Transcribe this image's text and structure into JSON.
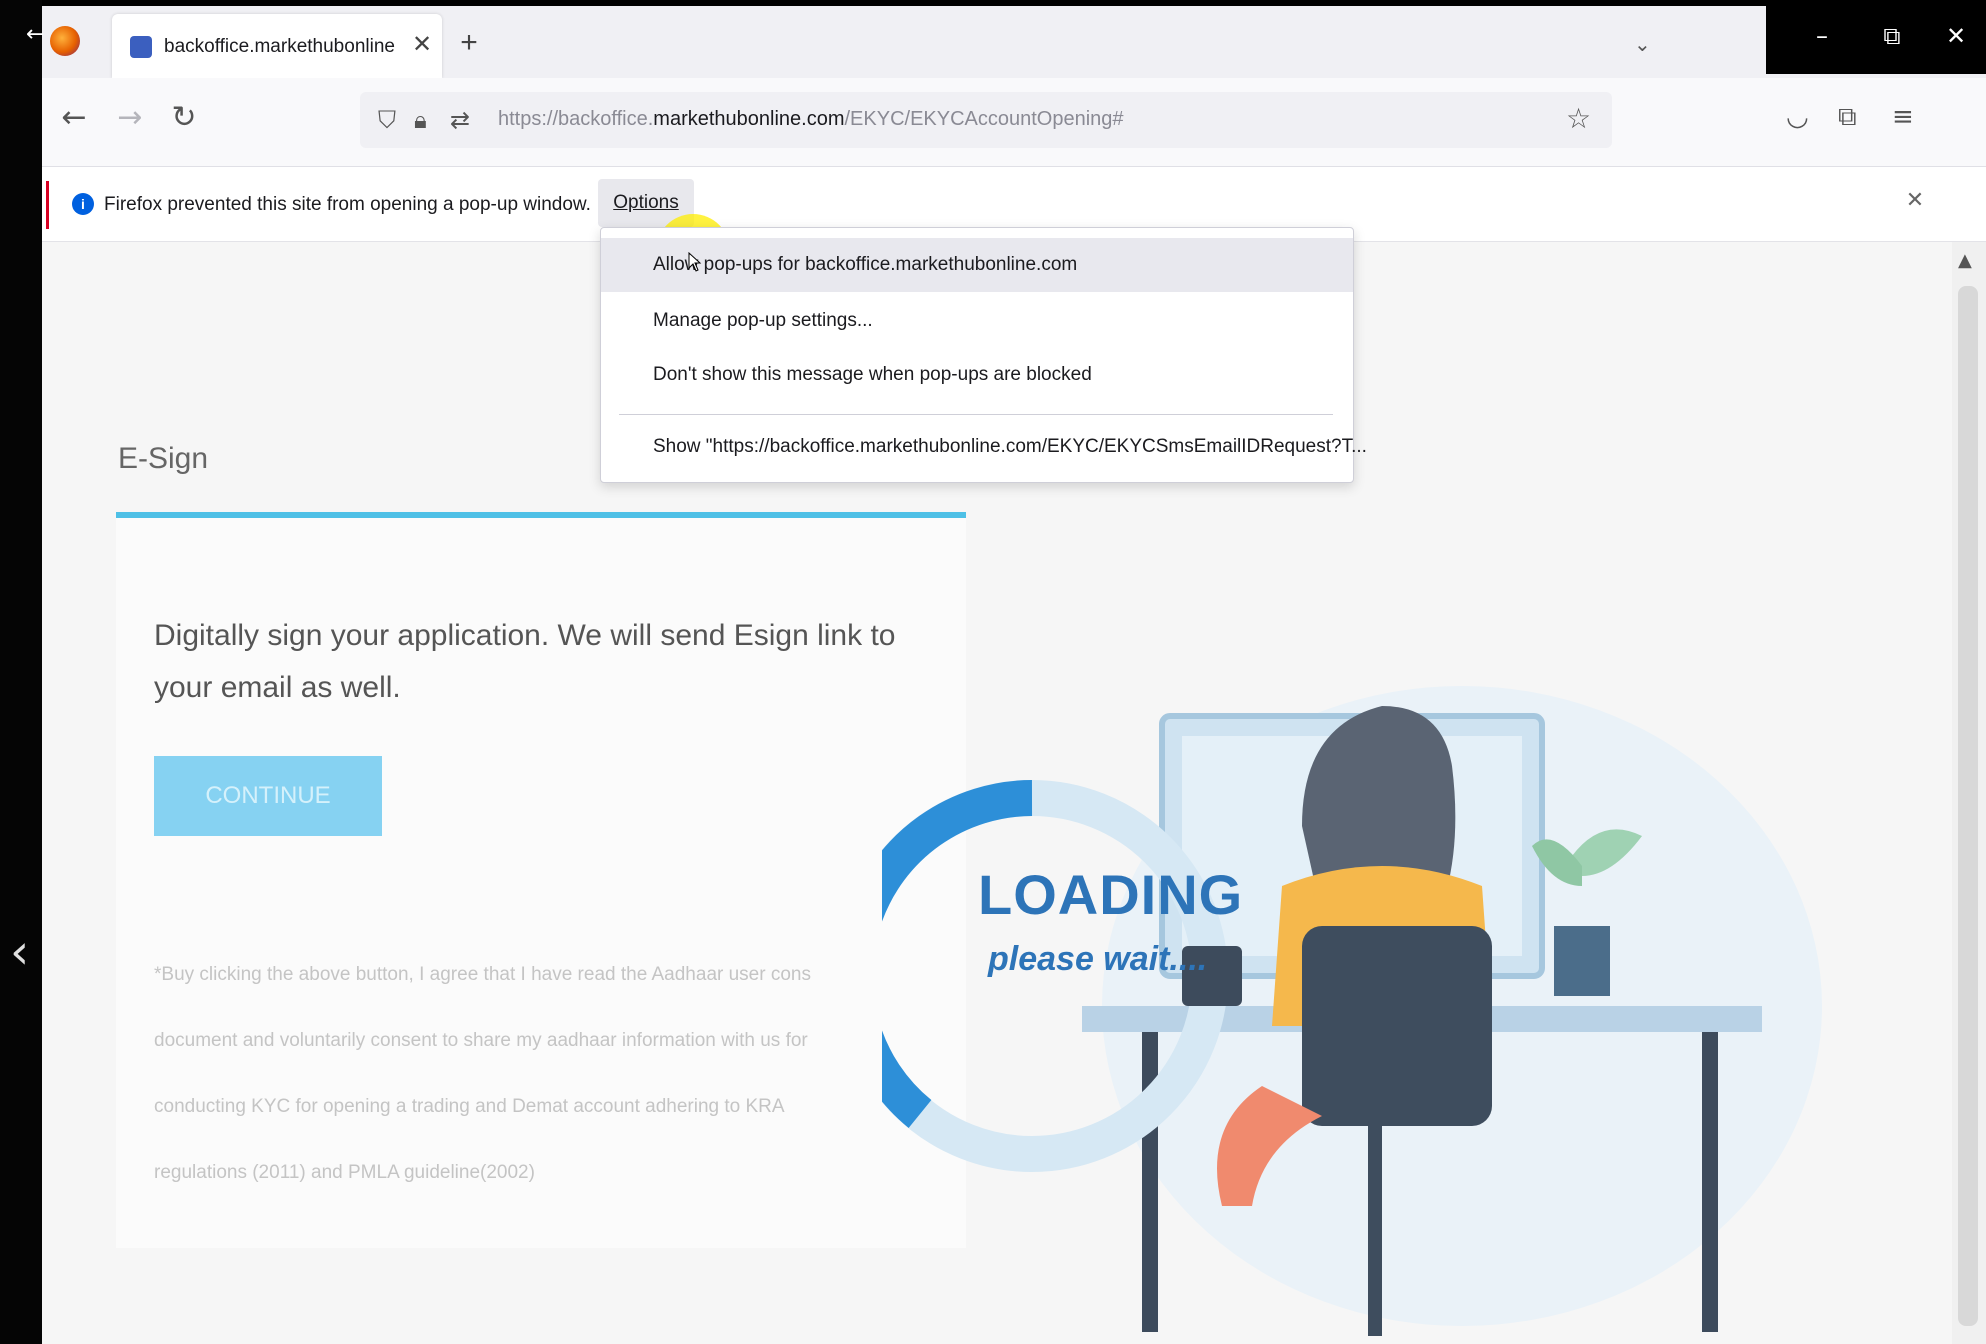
{
  "browser": {
    "tab": {
      "title": "backoffice.markethubonline.co",
      "close": "✕"
    },
    "new_tab": "+",
    "tab_list": "⌄",
    "window": {
      "minimize": "–",
      "restore": "⧉",
      "close": "✕"
    },
    "nav": {
      "back": "←",
      "forward": "→",
      "reload": "↻"
    },
    "url": {
      "prefix": "https://backoffice.",
      "domain": "markethubonline.com",
      "path": "/EKYC/EKYCAccountOpening#"
    },
    "icons": {
      "tracking": "shield-outline-icon",
      "lock": "lock-icon",
      "permissions": "permissions-icon",
      "bookmark": "star-icon",
      "pocket": "pocket-icon",
      "extensions": "extensions-icon",
      "menu": "hamburger-menu-icon"
    }
  },
  "notification": {
    "message": "Firefox prevented this site from opening a pop-up window.",
    "options_label": "Options",
    "close": "✕"
  },
  "popup_menu": {
    "items": [
      "Allow pop-ups for backoffice.markethubonline.com",
      "Manage pop-up settings...",
      "Don't show this message when pop-ups are blocked",
      "Show \"https://backoffice.markethubonline.com/EKYC/EKYCSmsEmailIDRequest?T..."
    ]
  },
  "page": {
    "section_title": "E-Sign",
    "instruction": "Digitally sign your application. We will send Esign link to your email as well.",
    "continue_label": "CONTINUE",
    "disclaimer_lines": [
      "*Buy clicking the above button, I agree that I have read the Aadhaar user cons",
      "document and voluntarily consent to share my aadhaar information with us for",
      "conducting KYC for opening a trading and Demat account adhering to KRA",
      "regulations (2011) and PMLA guideline(2002)"
    ],
    "loading_title": "LOADING",
    "loading_subtitle": "please wait....",
    "accent_color": "#4ec0e6",
    "button_color": "#86d2f2"
  }
}
